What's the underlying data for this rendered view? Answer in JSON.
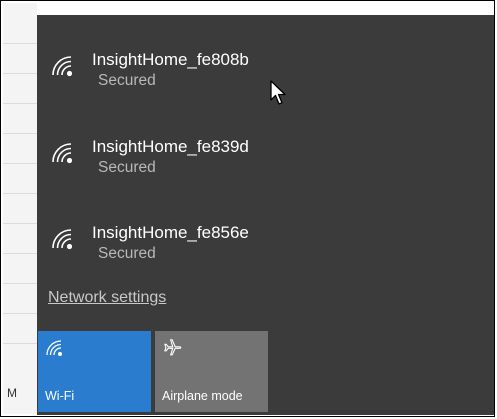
{
  "flyout": {
    "networks": [
      {
        "name": "InsightHome_fe808b",
        "status": "Secured",
        "icon": "wifi-signal-icon"
      },
      {
        "name": "InsightHome_fe839d",
        "status": "Secured",
        "icon": "wifi-signal-icon"
      },
      {
        "name": "InsightHome_fe856e",
        "status": "Secured",
        "icon": "wifi-signal-icon"
      }
    ],
    "network_settings_label": "Network settings",
    "quick_actions": [
      {
        "label": "Wi-Fi",
        "icon": "wifi-icon",
        "state": "on",
        "color": "#2a7ccf"
      },
      {
        "label": "Airplane mode",
        "icon": "airplane-icon",
        "state": "off",
        "color": "#737373"
      }
    ]
  },
  "background": {
    "partial_letter": "M"
  },
  "colors": {
    "flyout_bg": "#3b3b3b",
    "accent": "#2a7ccf",
    "secondary_text": "#b8b8b8"
  }
}
